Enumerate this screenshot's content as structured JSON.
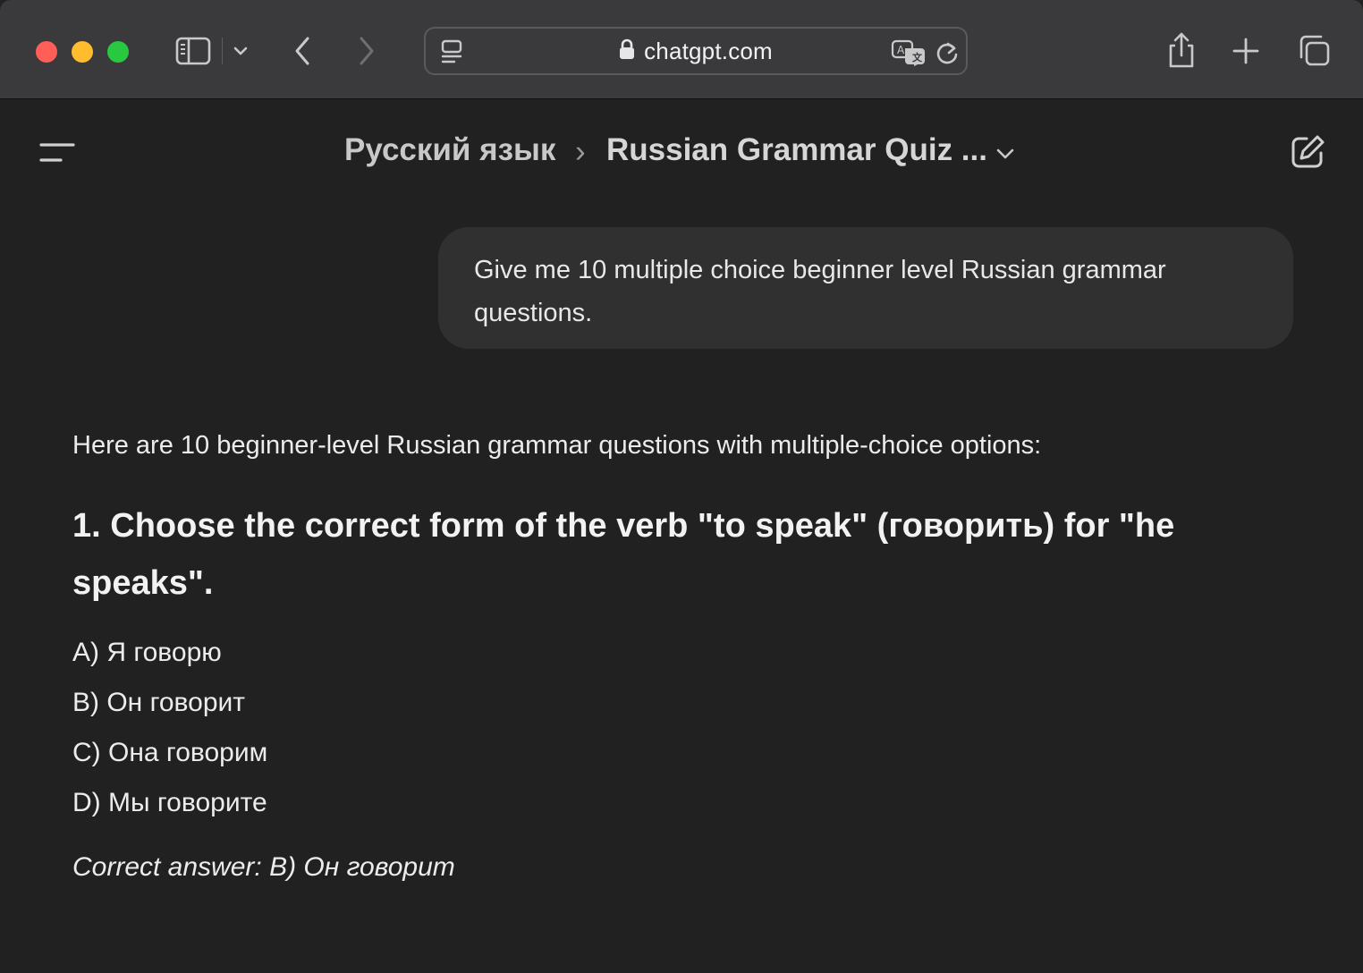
{
  "browser": {
    "url": "chatgpt.com",
    "icons": {
      "sidebar": "sidebar-toggle-icon",
      "sidebar_menu": "chevron-down-icon",
      "back": "chevron-left-icon",
      "forward": "chevron-right-icon",
      "reader": "page-menu-icon",
      "lock": "lock-icon",
      "translate": "translate-icon",
      "reload": "reload-icon",
      "share": "share-icon",
      "new_tab": "plus-icon",
      "tabs": "tab-overview-icon"
    }
  },
  "header": {
    "project": "Русский язык",
    "separator": "›",
    "chat_title": "Russian Grammar Quiz ...",
    "icons": {
      "menu": "menu-icon",
      "title_menu": "chevron-down-icon",
      "new_chat": "new-chat-icon"
    }
  },
  "conversation": {
    "user_message": "Give me 10 multiple choice beginner level Russian grammar questions.",
    "assistant": {
      "intro": "Here are 10 beginner-level Russian grammar questions with multiple-choice options:",
      "question_1": {
        "heading": "1. Choose the correct form of the verb \"to speak\" (говорить) for \"he speaks\".",
        "options": [
          "A) Я говорю",
          "B) Он говорит",
          "C) Она говорим",
          "D) Мы говорите"
        ],
        "answer": "Correct answer: B) Он говорит"
      }
    }
  },
  "colors": {
    "background": "#212121",
    "toolbar": "#3a3a3c",
    "user_bubble": "#303030",
    "text": "#ececec",
    "traffic_close": "#ff5f57",
    "traffic_minimize": "#febc2e",
    "traffic_maximize": "#28c840"
  }
}
